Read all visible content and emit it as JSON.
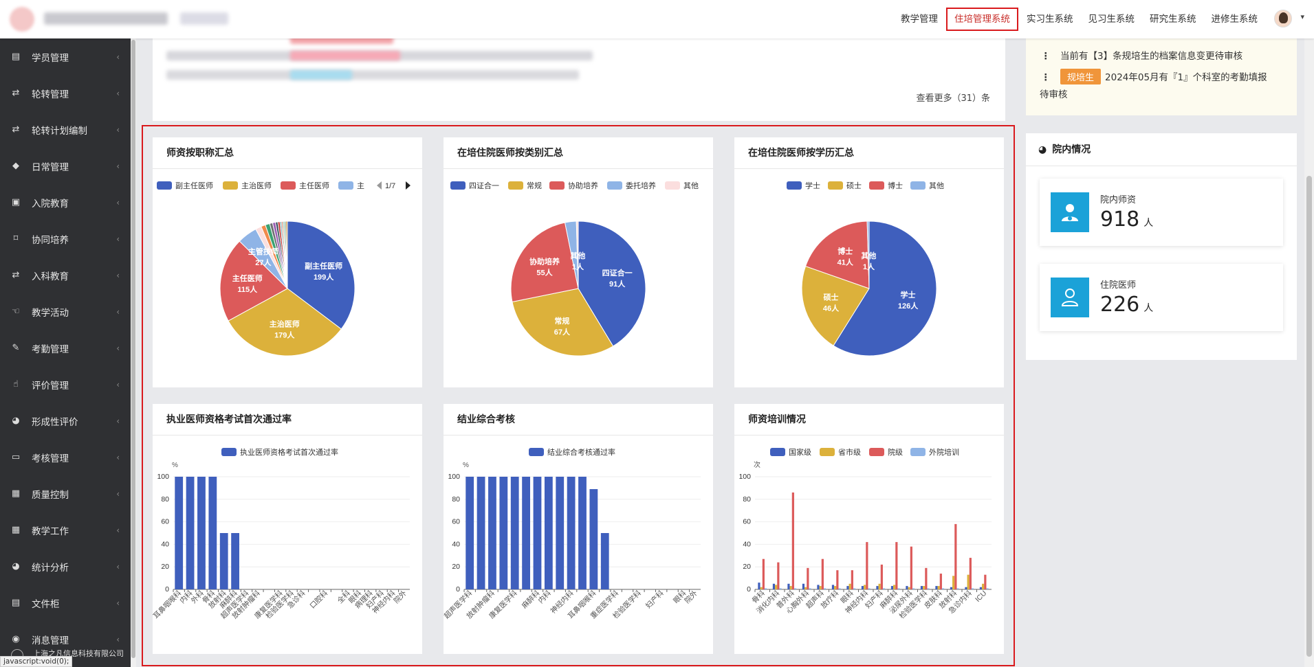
{
  "topnav": {
    "items": [
      "教学管理",
      "住培管理系统",
      "实习生系统",
      "见习生系统",
      "研究生系统",
      "进修生系统"
    ],
    "active_index": 1
  },
  "sidebar": {
    "items": [
      {
        "label": "学员管理",
        "icon": "id-card-icon"
      },
      {
        "label": "轮转管理",
        "icon": "retweet-icon"
      },
      {
        "label": "轮转计划编制",
        "icon": "retweet-icon"
      },
      {
        "label": "日常管理",
        "icon": "tag-icon"
      },
      {
        "label": "入院教育",
        "icon": "clipboard-icon"
      },
      {
        "label": "协同培养",
        "icon": "bookmark-icon"
      },
      {
        "label": "入科教育",
        "icon": "retweet-icon"
      },
      {
        "label": "教学活动",
        "icon": "hand-icon"
      },
      {
        "label": "考勤管理",
        "icon": "brush-icon"
      },
      {
        "label": "评价管理",
        "icon": "thumbs-up-icon"
      },
      {
        "label": "形成性评价",
        "icon": "pie-icon"
      },
      {
        "label": "考核管理",
        "icon": "monitor-icon"
      },
      {
        "label": "质量控制",
        "icon": "list-card-icon"
      },
      {
        "label": "教学工作",
        "icon": "calendar-icon"
      },
      {
        "label": "统计分析",
        "icon": "pie-icon"
      },
      {
        "label": "文件柜",
        "icon": "archive-icon"
      },
      {
        "label": "消息管理",
        "icon": "bell-icon"
      }
    ],
    "copyright": "上海之凡信息科技有限公司"
  },
  "status_url": "javascript:void(0);",
  "notice": {
    "view_more": "查看更多（31）条"
  },
  "todo": {
    "line1": "当前有【3】条规培生的档案信息变更待审核",
    "badge": "规培生",
    "line2": "2024年05月有『1』个科室的考勤填报",
    "line2b": "待审核"
  },
  "hospital": {
    "title": "院内情况",
    "stats": [
      {
        "label": "院内师资",
        "value": "918",
        "unit": "人",
        "icon": "teacher-icon"
      },
      {
        "label": "住院医师",
        "value": "226",
        "unit": "人",
        "icon": "user-icon"
      }
    ]
  },
  "colors": {
    "blue": "#3f5fbd",
    "yellow": "#dcb13b",
    "red": "#dc5a5a",
    "light_blue": "#8fb4e6",
    "pink": "#fbdede",
    "accent": "#d9191c",
    "teal": "#1ba2d8"
  },
  "chart_data": [
    {
      "type": "pie",
      "title": "师资按职称汇总",
      "legend": [
        "副主任医师",
        "主治医师",
        "主任医师",
        "主"
      ],
      "legend_page": "1/7",
      "slices": [
        {
          "label": "副主任医师",
          "value": 199,
          "color": "#3f5fbd"
        },
        {
          "label": "主治医师",
          "value": 179,
          "color": "#dcb13b"
        },
        {
          "label": "主任医师",
          "value": 115,
          "color": "#dc5a5a"
        },
        {
          "label": "主管技师",
          "value": 27,
          "color": "#8fb4e6"
        },
        {
          "label": "",
          "value": 8,
          "color": "#fbdede"
        },
        {
          "label": "",
          "value": 6,
          "color": "#f08a4b"
        },
        {
          "label": "",
          "value": 6,
          "color": "#3ba272"
        },
        {
          "label": "",
          "value": 4,
          "color": "#6e7074"
        },
        {
          "label": "",
          "value": 4,
          "color": "#9a60b4"
        },
        {
          "label": "",
          "value": 3,
          "color": "#2f4554"
        },
        {
          "label": "",
          "value": 3,
          "color": "#c23531"
        },
        {
          "label": "",
          "value": 2,
          "color": "#61a0a8"
        },
        {
          "label": "",
          "value": 2,
          "color": "#d48265"
        },
        {
          "label": "",
          "value": 2,
          "color": "#91c7ae"
        },
        {
          "label": "",
          "value": 2,
          "color": "#749f83"
        },
        {
          "label": "",
          "value": 2,
          "color": "#ca8622"
        }
      ],
      "slice_texts": [
        {
          "name": "副主任医师",
          "count": "199人"
        },
        {
          "name": "主治医师",
          "count": "179人"
        },
        {
          "name": "主任医师",
          "count": "115人"
        },
        {
          "name": "主管技师",
          "count": "27人"
        }
      ]
    },
    {
      "type": "pie",
      "title": "在培住院医师按类别汇总",
      "legend": [
        "四证合一",
        "常规",
        "协助培养",
        "委托培养",
        "其他"
      ],
      "slices": [
        {
          "label": "四证合一",
          "value": 91,
          "color": "#3f5fbd"
        },
        {
          "label": "常规",
          "value": 67,
          "color": "#dcb13b"
        },
        {
          "label": "协助培养",
          "value": 55,
          "color": "#dc5a5a"
        },
        {
          "label": "委托培养",
          "value": 6,
          "color": "#8fb4e6"
        },
        {
          "label": "其他",
          "value": 1,
          "color": "#fbdede"
        }
      ],
      "slice_texts": [
        {
          "name": "四证合一",
          "count": "91人"
        },
        {
          "name": "常规",
          "count": "67人"
        },
        {
          "name": "协助培养",
          "count": "55人"
        },
        {
          "name": "其他",
          "count": "1人"
        }
      ]
    },
    {
      "type": "pie",
      "title": "在培住院医师按学历汇总",
      "legend": [
        "学士",
        "硕士",
        "博士",
        "其他"
      ],
      "slices": [
        {
          "label": "学士",
          "value": 126,
          "color": "#3f5fbd"
        },
        {
          "label": "硕士",
          "value": 46,
          "color": "#dcb13b"
        },
        {
          "label": "博士",
          "value": 41,
          "color": "#dc5a5a"
        },
        {
          "label": "其他",
          "value": 1,
          "color": "#8fb4e6"
        }
      ],
      "slice_texts": [
        {
          "name": "学士",
          "count": "126人"
        },
        {
          "name": "硕士",
          "count": "46人"
        },
        {
          "name": "博士",
          "count": "41人"
        },
        {
          "name": "其他",
          "count": "1人"
        }
      ]
    },
    {
      "type": "bar",
      "title": "执业医师资格考试首次通过率",
      "legend": [
        "执业医师资格考试首次通过率"
      ],
      "ylabel": "%",
      "ylim": [
        0,
        100
      ],
      "yticks": [
        0,
        20,
        40,
        60,
        80,
        100
      ],
      "categories": [
        "耳鼻咽喉科",
        "内科",
        "外科",
        "骨科",
        "放射科",
        "麻醉科",
        "超声医学科",
        "放射肿瘤科",
        "",
        "康复医学科",
        "检验医学科",
        "急诊科",
        "",
        "口腔科",
        "",
        "全科",
        "眼科",
        "病理科",
        "妇产科",
        "神经内科",
        "院外"
      ],
      "values": [
        100,
        100,
        100,
        100,
        50,
        50,
        0,
        0,
        0,
        0,
        0,
        0,
        0,
        0,
        0,
        0,
        0,
        0,
        0,
        0,
        0
      ],
      "series_color": "#3f5fbd"
    },
    {
      "type": "bar",
      "title": "结业综合考核",
      "legend": [
        "结业综合考核通过率"
      ],
      "ylabel": "%",
      "ylim": [
        0,
        100
      ],
      "yticks": [
        0,
        20,
        40,
        60,
        80,
        100
      ],
      "categories": [
        "超声医学科",
        "",
        "放射肿瘤科",
        "",
        "康复医学科",
        "",
        "麻醉科",
        "内科",
        "",
        "神经内科",
        "",
        "耳鼻咽喉科",
        "",
        "重症医学科",
        "",
        "检验医学科",
        "",
        "妇产科",
        "",
        "眼科",
        "院外"
      ],
      "values": [
        100,
        100,
        100,
        100,
        100,
        100,
        100,
        100,
        100,
        100,
        100,
        89,
        50,
        0,
        0,
        0,
        0,
        0,
        0,
        0,
        0
      ],
      "series_color": "#3f5fbd"
    },
    {
      "type": "bar",
      "title": "师资培训情况",
      "legend": [
        "国家级",
        "省市级",
        "院级",
        "外院培训"
      ],
      "ylabel": "次",
      "ylim": [
        0,
        100
      ],
      "yticks": [
        0,
        20,
        40,
        60,
        80,
        100
      ],
      "categories": [
        "骨科",
        "消化内科",
        "普外科",
        "心胸外科",
        "超声科",
        "放疗科",
        "眼科",
        "神经内科",
        "妇产科",
        "麻醉科",
        "泌尿外科",
        "检验医学科",
        "皮肤科",
        "放射科",
        "急诊内科",
        "ICU"
      ],
      "series": [
        {
          "name": "国家级",
          "color": "#3f5fbd",
          "values": [
            6,
            5,
            5,
            5,
            4,
            4,
            3,
            3,
            3,
            3,
            3,
            3,
            3,
            2,
            2,
            2
          ]
        },
        {
          "name": "省市级",
          "color": "#dcb13b",
          "values": [
            2,
            4,
            3,
            2,
            3,
            3,
            5,
            4,
            5,
            4,
            2,
            3,
            3,
            12,
            13,
            5
          ]
        },
        {
          "name": "院级",
          "color": "#dc5a5a",
          "values": [
            27,
            24,
            86,
            19,
            27,
            17,
            17,
            42,
            22,
            42,
            38,
            19,
            14,
            58,
            28,
            13
          ]
        },
        {
          "name": "外院培训",
          "color": "#8fb4e6",
          "values": [
            1,
            1,
            1,
            1,
            1,
            1,
            1,
            1,
            1,
            1,
            1,
            1,
            1,
            1,
            1,
            1
          ]
        }
      ]
    }
  ]
}
